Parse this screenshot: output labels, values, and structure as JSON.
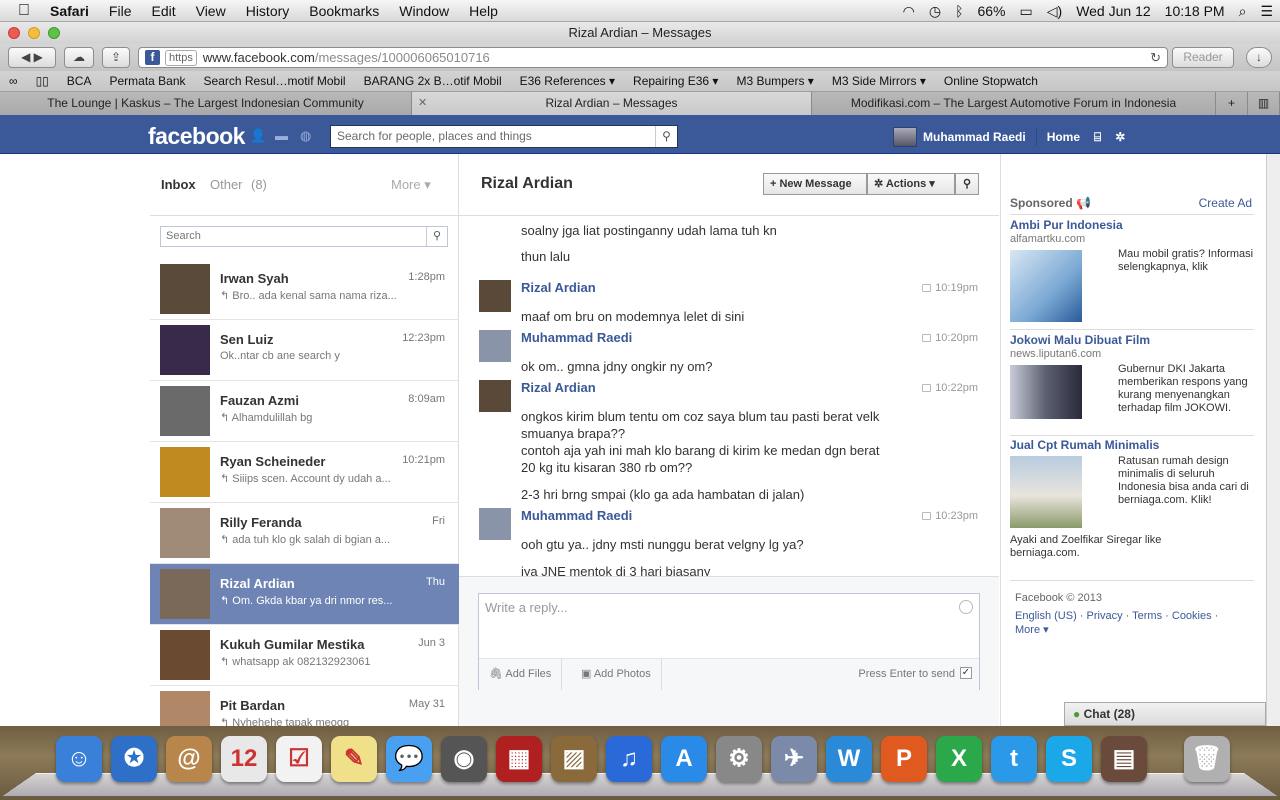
{
  "menubar": {
    "app": "Safari",
    "items": [
      "File",
      "Edit",
      "View",
      "History",
      "Bookmarks",
      "Window",
      "Help"
    ],
    "battery": "66%",
    "datetime": "Wed Jun 12",
    "clock": "10:18 PM"
  },
  "window": {
    "title": "Rizal Ardian – Messages",
    "url_scheme": "https",
    "url_host": "www.facebook.com",
    "url_path": "/messages/100006065010716",
    "reader": "Reader"
  },
  "bookmarks": [
    "BCA",
    "Permata Bank",
    "Search Resul…motif Mobil",
    "BARANG 2x B…otif Mobil",
    "E36 References ▾",
    "Repairing E36 ▾",
    "M3 Bumpers ▾",
    "M3 Side Mirrors ▾",
    "Online Stopwatch"
  ],
  "tabs": [
    {
      "label": "The Lounge | Kaskus – The Largest Indonesian Community",
      "active": false
    },
    {
      "label": "Rizal Ardian – Messages",
      "active": true
    },
    {
      "label": "Modifikasi.com – The Largest Automotive Forum in Indonesia",
      "active": false
    }
  ],
  "facebook": {
    "logo": "facebook",
    "search_placeholder": "Search for people, places and things",
    "user": "Muhammad Raedi",
    "home": "Home"
  },
  "inbox": {
    "tab_inbox": "Inbox",
    "tab_other": "Other",
    "other_count": "(8)",
    "more": "More ▾",
    "search_placeholder": "Search",
    "threads": [
      {
        "name": "Irwan Syah",
        "time": "1:28pm",
        "snippet": "↰ Bro.. ada kenal sama nama riza...",
        "color": "#5a4a3a"
      },
      {
        "name": "Sen Luiz",
        "time": "12:23pm",
        "snippet": "Ok..ntar cb ane search y",
        "color": "#3a2a4a"
      },
      {
        "name": "Fauzan Azmi",
        "time": "8:09am",
        "snippet": "↰ Alhamdulillah bg",
        "color": "#6a6a6a"
      },
      {
        "name": "Ryan Scheineder",
        "time": "10:21pm",
        "snippet": "↰ Siiips scen. Account dy udah a...",
        "color": "#c08a20"
      },
      {
        "name": "Rilly Feranda",
        "time": "Fri",
        "snippet": "↰ ada tuh klo gk salah di bgian a...",
        "color": "#a08a78"
      },
      {
        "name": "Rizal Ardian",
        "time": "Thu",
        "snippet": "↰ Om. Gkda kbar ya dri nmor res...",
        "color": "#7a6858",
        "selected": true
      },
      {
        "name": "Kukuh Gumilar Mestika",
        "time": "Jun 3",
        "snippet": "↰ whatsapp ak 082132923061",
        "color": "#6a4a30"
      },
      {
        "name": "Pit Bardan",
        "time": "May 31",
        "snippet": "↰ Nyhehehe tapak meogg",
        "color": "#b08868"
      }
    ]
  },
  "conversation": {
    "title": "Rizal Ardian",
    "new_message": "+ New Message",
    "actions": "✲ Actions ▾",
    "messages": [
      {
        "who": "",
        "time": "",
        "lines": [
          "soalny jga liat postinganny udah lama tuh kn",
          "thun lalu"
        ]
      },
      {
        "who": "Rizal Ardian",
        "time": "10:19pm",
        "lines": [
          "maaf om bru on modemnya lelet di sini"
        ]
      },
      {
        "who": "Muhammad Raedi",
        "time": "10:20pm",
        "lines": [
          "ok om.. gmna jdny ongkir ny om?"
        ]
      },
      {
        "who": "Rizal Ardian",
        "time": "10:22pm",
        "lines": [
          "ongkos kirim blum tentu om coz saya blum tau pasti berat velk",
          "smuanya brapa??",
          "contoh aja yah ini mah klo barang di kirim ke medan dgn berat",
          "20 kg itu kisaran 380 rb om??",
          "2-3 hri brng smpai (klo ga ada hambatan di jalan)"
        ]
      },
      {
        "who": "Muhammad Raedi",
        "time": "10:23pm",
        "lines": [
          "ooh gtu ya.. jdny msti nunggu berat velgny lg ya?",
          "iya JNE mentok di 3 hari biasany"
        ]
      }
    ],
    "reply_placeholder": "Write a reply...",
    "add_files": "Add Files",
    "add_photos": "Add Photos",
    "press_enter": "Press Enter to send"
  },
  "sidebar": {
    "sponsored": "Sponsored",
    "create_ad": "Create Ad",
    "ads": [
      {
        "title": "Ambi Pur Indonesia",
        "url": "alfamartku.com",
        "body": "Mau mobil gratis? Informasi selengkapnya, klik"
      },
      {
        "title": "Jokowi Malu Dibuat Film",
        "url": "news.liputan6.com",
        "body": "Gubernur DKI Jakarta memberikan respons yang kurang menyenangkan terhadap film JOKOWI."
      },
      {
        "title": "Jual Cpt Rumah Minimalis",
        "url": "",
        "body": "Ratusan rumah design minimalis di seluruh Indonesia bisa anda cari di berniaga.com. Klik!"
      }
    ],
    "social": "Ayaki and Zoelfikar Siregar like berniaga.com.",
    "copyright": "Facebook © 2013",
    "footer_links": "English (US) · Privacy · Terms · Cookies · More ▾"
  },
  "chat": {
    "label": "Chat (28)"
  },
  "dock": {
    "apps": [
      {
        "name": "finder",
        "color": "#3a7fd8"
      },
      {
        "name": "safari",
        "color": "#2e6fc8"
      },
      {
        "name": "address-book",
        "color": "#b8864a"
      },
      {
        "name": "ical",
        "color": "#e8e8e8"
      },
      {
        "name": "reminders",
        "color": "#f2f2f2"
      },
      {
        "name": "stickies",
        "color": "#f0e08a"
      },
      {
        "name": "messages",
        "color": "#4aa0f0"
      },
      {
        "name": "facetime",
        "color": "#555555"
      },
      {
        "name": "photo-booth",
        "color": "#b02020"
      },
      {
        "name": "iphoto",
        "color": "#8a6a3a"
      },
      {
        "name": "itunes",
        "color": "#2a6ad8"
      },
      {
        "name": "app-store",
        "color": "#2a8ae8"
      },
      {
        "name": "system-preferences",
        "color": "#888888"
      },
      {
        "name": "preview",
        "color": "#7a8aa8"
      },
      {
        "name": "word",
        "color": "#2a8ad8"
      },
      {
        "name": "powerpoint",
        "color": "#e05a20"
      },
      {
        "name": "excel",
        "color": "#2aa84a"
      },
      {
        "name": "twitter",
        "color": "#2a9ae8"
      },
      {
        "name": "skype",
        "color": "#1aa8e8"
      },
      {
        "name": "document",
        "color": "#6a4a3a"
      },
      {
        "name": "trash",
        "color": "#b0b0b0"
      }
    ]
  }
}
